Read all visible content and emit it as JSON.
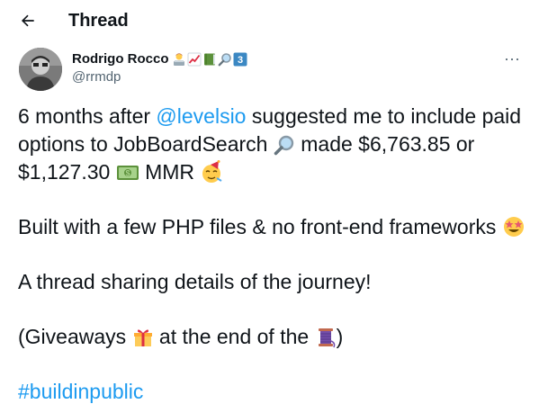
{
  "header": {
    "back_icon": "arrow-left-icon",
    "title": "Thread"
  },
  "author": {
    "display_name": "Rodrigo Rocco",
    "handle": "@rrmdp",
    "name_emojis": [
      "technologist-icon",
      "chart-increasing-icon",
      "green-book-icon",
      "magnifying-glass-icon",
      "keycap-3-icon"
    ],
    "more_icon": "ellipsis-icon",
    "more_label": "···"
  },
  "tweet": {
    "p1_a": "6 months after ",
    "p1_mention": "@levelsio",
    "p1_b": " suggested me to include paid options to JobBoardSearch ",
    "p1_c": " made $6,763.85 or $1,127.30 ",
    "p1_d": " MMR ",
    "p2": "Built with a few PHP files & no front-end frameworks ",
    "p3": "A thread sharing details of the journey!",
    "p4_a": "(Giveaways ",
    "p4_b": " at the end of the ",
    "p4_c": ")",
    "hashtag": "#buildinpublic"
  },
  "colors": {
    "link": "#1d9bf0",
    "text": "#0f1419",
    "muted": "#536471"
  }
}
